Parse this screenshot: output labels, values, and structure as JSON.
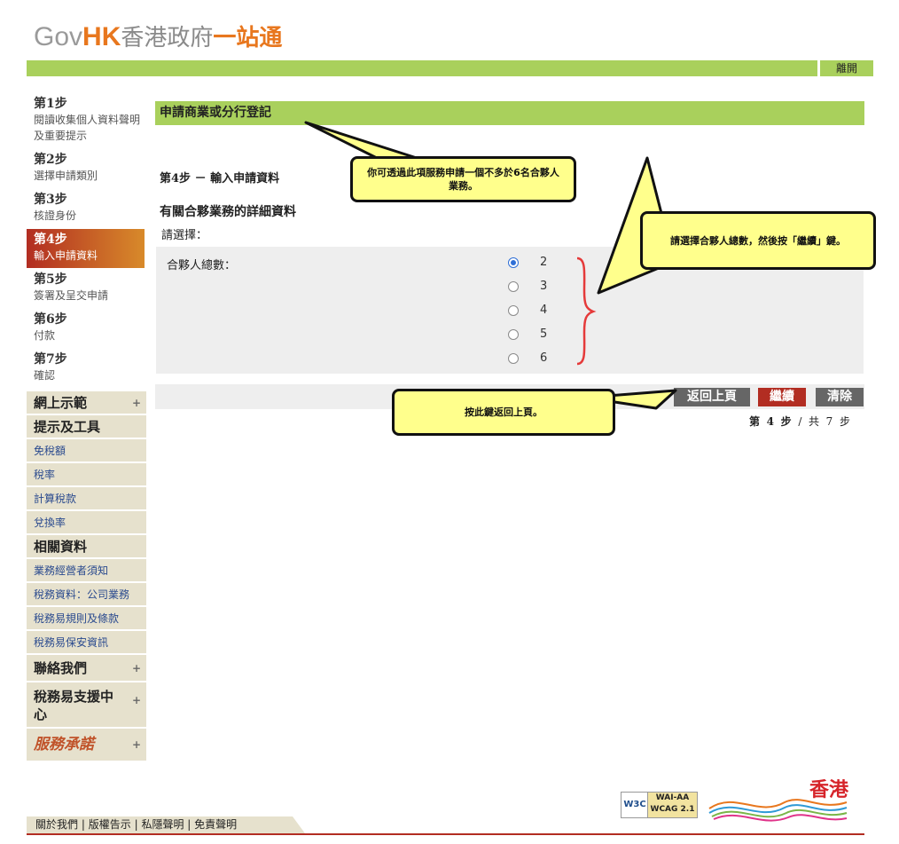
{
  "logo": {
    "gov": "Gov",
    "hk": "HK",
    "zh": "香港政府",
    "zh2": "一站通"
  },
  "header": {
    "logout": "離開"
  },
  "steps": [
    {
      "title": "第1步",
      "desc": "閱讀收集個人資料聲明及重要提示"
    },
    {
      "title": "第2步",
      "desc": "選擇申請類別"
    },
    {
      "title": "第3步",
      "desc": "核證身份"
    },
    {
      "title": "第4步",
      "desc": "輸入申請資料"
    },
    {
      "title": "第5步",
      "desc": "簽署及呈交申請"
    },
    {
      "title": "第6步",
      "desc": "付款"
    },
    {
      "title": "第7步",
      "desc": "確認"
    }
  ],
  "menu": {
    "demo": "網上示範",
    "tips": "提示及工具",
    "tips_items": [
      "免稅額",
      "稅率",
      "計算稅款",
      "兌換率"
    ],
    "related": "相關資料",
    "related_items": [
      "業務經營者須知",
      "稅務資料：公司業務",
      "稅務易規則及條款",
      "稅務易保安資訊"
    ],
    "contact": "聯絡我們",
    "support": "稅務易支援中心",
    "pledge": "服務承諾"
  },
  "main": {
    "form_title": "申請商業或分行登記",
    "step_title": "第4步 － 輸入申請資料",
    "section_title": "有關合夥業務的詳細資料",
    "please_choose": "請選擇：",
    "question": "合夥人總數：",
    "options": [
      "2",
      "3",
      "4",
      "5",
      "6"
    ],
    "selected": "2"
  },
  "buttons": {
    "back": "返回上頁",
    "next": "繼續",
    "clear": "清除"
  },
  "pager": {
    "a": "第",
    "cur": "4",
    "b": "步",
    "sep": "/",
    "c": "共",
    "total": "7",
    "d": "步"
  },
  "callouts": {
    "c1": "你可透過此項服務申請一個不多於6名合夥人業務。",
    "c2": "請選擇合夥人總數，然後按「繼續」鍵。",
    "c3": "按此鍵返回上頁。"
  },
  "footer": {
    "links": [
      "關於我們",
      "版權告示",
      "私隱聲明",
      "免責聲明"
    ],
    "sep": "|"
  },
  "badges": {
    "w3c": "W3C",
    "wai": "WAI-AA",
    "wcag": "WCAG 2.1",
    "hk": "香港"
  },
  "colors": {
    "green": "#a9d05c",
    "red": "#b22d22",
    "yellow": "#ffff8c"
  }
}
